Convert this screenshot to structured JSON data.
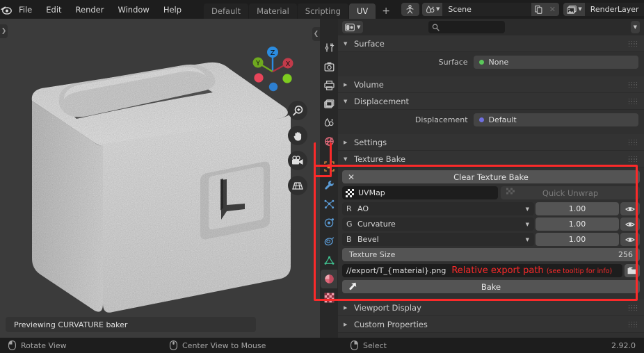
{
  "topbar": {
    "logo_icon": "blender-logo-icon",
    "menus": [
      "File",
      "Edit",
      "Render",
      "Window",
      "Help"
    ],
    "workspace_tabs": [
      {
        "label": "Default",
        "active": false
      },
      {
        "label": "Material",
        "active": false
      },
      {
        "label": "Scripting",
        "active": false
      },
      {
        "label": "UV",
        "active": true
      }
    ],
    "add_workspace_label": "+",
    "scene_icon": "scene-icon",
    "scene_name": "Scene",
    "scene_new_icon": "duplicate-icon",
    "scene_unlink_icon": "close-icon",
    "viewlayer_icon": "render-layers-icon",
    "viewlayer_name": "RenderLayer",
    "viewlayer_new_icon": "duplicate-icon",
    "viewlayer_remove_icon": "close-icon",
    "editor_type_icon": "editor-type-icon"
  },
  "viewport": {
    "collapse_left_icon": "chevron-right-icon",
    "collapse_right_icon": "chevron-left-icon",
    "gizmo": {
      "axes": [
        {
          "label": "Z",
          "color": "#2b8ce0"
        },
        {
          "label": "Y",
          "color": "#6fa81f"
        },
        {
          "label": "X",
          "color": "#d6394a"
        }
      ],
      "negative_colors": [
        "#e8455a",
        "#7ecc20",
        "#2d7fd0"
      ]
    },
    "tools": [
      {
        "name": "zoom-view-icon"
      },
      {
        "name": "move-view-icon"
      },
      {
        "name": "camera-view-icon"
      },
      {
        "name": "toggle-orthographic-icon"
      }
    ],
    "status_text": "Previewing CURVATURE baker"
  },
  "properties": {
    "tabs": [
      {
        "name": "tool-tab",
        "icon": "tool-icon",
        "color": "#c8c8c8",
        "active": false
      },
      {
        "name": "render-tab",
        "icon": "camera-back-icon",
        "color": "#c8c8c8",
        "active": false
      },
      {
        "name": "output-tab",
        "icon": "printer-icon",
        "color": "#c8c8c8",
        "active": false
      },
      {
        "name": "view-layer-tab",
        "icon": "images-icon",
        "color": "#c8c8c8",
        "active": false
      },
      {
        "name": "scene-tab",
        "icon": "cone-droplet-icon",
        "color": "#c8c8c8",
        "active": false
      },
      {
        "name": "world-tab",
        "icon": "world-icon",
        "color": "#e0697a",
        "active": false
      },
      {
        "name": "object-tab",
        "icon": "object-square-icon",
        "color": "#e08d3c",
        "active": false
      },
      {
        "name": "modifier-tab",
        "icon": "wrench-icon",
        "color": "#5b9bd5",
        "active": false
      },
      {
        "name": "particles-tab",
        "icon": "particles-icon",
        "color": "#5b9bd5",
        "active": false
      },
      {
        "name": "physics-tab",
        "icon": "physics-orbit-icon",
        "color": "#5b9bd5",
        "active": false
      },
      {
        "name": "constraints-tab",
        "icon": "constraint-icon",
        "color": "#5b9bd5",
        "active": false
      },
      {
        "name": "object-data-tab",
        "icon": "mesh-data-icon",
        "color": "#3fbf8f",
        "active": false
      },
      {
        "name": "material-tab",
        "icon": "material-sphere-icon",
        "color": "#e0697a",
        "active": true
      },
      {
        "name": "texture-tab",
        "icon": "checker-texture-icon",
        "color": "#e0697a",
        "active": false
      }
    ],
    "header": {
      "editor_icon": "properties-editor-icon",
      "search_placeholder": "",
      "search_icon": "search-icon",
      "filter_icon": "chevron-down-icon"
    },
    "panels": [
      {
        "id": "surface",
        "label": "Surface",
        "open": true,
        "rows": [
          {
            "label": "Surface",
            "value": "None",
            "dot_color": "#5ac85a"
          }
        ]
      },
      {
        "id": "volume",
        "label": "Volume",
        "open": false,
        "rows": []
      },
      {
        "id": "displacement",
        "label": "Displacement",
        "open": true,
        "rows": [
          {
            "label": "Displacement",
            "value": "Default",
            "dot_color": "#6f6fe0"
          }
        ]
      },
      {
        "id": "settings",
        "label": "Settings",
        "open": false,
        "rows": []
      },
      {
        "id": "texture_bake",
        "label": "Texture Bake",
        "open": true,
        "rows": []
      },
      {
        "id": "viewport_display",
        "label": "Viewport Display",
        "open": false,
        "rows": []
      },
      {
        "id": "custom_properties",
        "label": "Custom Properties",
        "open": false,
        "rows": []
      }
    ],
    "texture_bake": {
      "clear_button_label": "Clear Texture Bake",
      "clear_button_icon": "x-icon",
      "uvmap_icon": "uv-grid-icon",
      "uvmap_name": "UVMap",
      "quick_unwrap_label": "Quick Unwrap",
      "quick_unwrap_icon": "uv-unwrap-icon",
      "channels": [
        {
          "slot": "R",
          "source": "AO",
          "value": "1.00",
          "eye_icon": "eye-icon"
        },
        {
          "slot": "G",
          "source": "Curvature",
          "value": "1.00",
          "eye_icon": "eye-icon"
        },
        {
          "slot": "B",
          "source": "Bevel",
          "value": "1.00",
          "eye_icon": "eye-icon"
        }
      ],
      "texture_size_label": "Texture Size",
      "texture_size_value": "256",
      "export_path": "//export/T_{material}.png",
      "annotation_main": "Relative export path",
      "annotation_sub": "(see tooltip for info)",
      "folder_icon": "folder-icon",
      "bake_button_label": "Bake",
      "bake_button_icon": "bake-arrow-icon",
      "highlight_color": "#fb2a2a"
    }
  },
  "statusbar": {
    "items": [
      {
        "icon": "mouse-left-icon",
        "label": "Rotate View"
      },
      {
        "icon": "mouse-middle-icon",
        "label": "Center View to Mouse"
      },
      {
        "icon": "mouse-right-icon",
        "label": "Select"
      }
    ],
    "version": "2.92.0"
  }
}
